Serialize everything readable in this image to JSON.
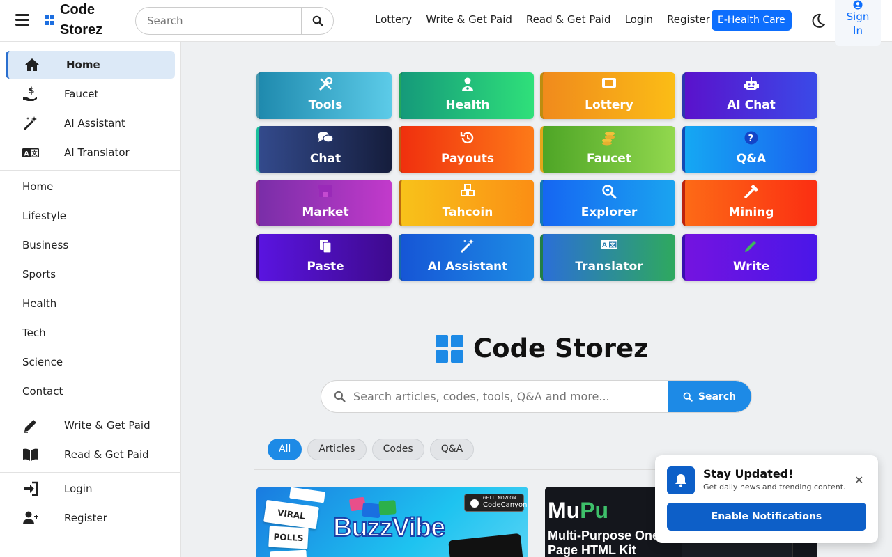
{
  "header": {
    "logo_text": "Code Storez",
    "search_placeholder": "Search",
    "nav": [
      "Lottery",
      "Write & Get Paid",
      "Read & Get Paid",
      "Login",
      "Register"
    ],
    "cta_label": "E-Health Care",
    "signin_label": "Sign In"
  },
  "sidebar": {
    "top_items": [
      "Home",
      "Faucet",
      "AI Assistant",
      "AI Translator"
    ],
    "categories": [
      "Home",
      "Lifestyle",
      "Business",
      "Sports",
      "Health",
      "Tech",
      "Science",
      "Contact"
    ],
    "earn_items": [
      "Write & Get Paid",
      "Read & Get Paid"
    ],
    "account_items": [
      "Login",
      "Register"
    ]
  },
  "tiles": [
    {
      "label": "Tools",
      "icon": "tools-icon"
    },
    {
      "label": "Health",
      "icon": "doctor-icon"
    },
    {
      "label": "Lottery",
      "icon": "ticket-icon"
    },
    {
      "label": "AI Chat",
      "icon": "robot-icon"
    },
    {
      "label": "Chat",
      "icon": "comments-icon"
    },
    {
      "label": "Payouts",
      "icon": "history-icon"
    },
    {
      "label": "Faucet",
      "icon": "coins-icon"
    },
    {
      "label": "Q&A",
      "icon": "question-icon"
    },
    {
      "label": "Market",
      "icon": "store-icon"
    },
    {
      "label": "Tahcoin",
      "icon": "cubes-icon"
    },
    {
      "label": "Explorer",
      "icon": "search-plus-icon"
    },
    {
      "label": "Mining",
      "icon": "hammer-icon"
    },
    {
      "label": "Paste",
      "icon": "paste-icon"
    },
    {
      "label": "AI Assistant",
      "icon": "magic-wand-icon"
    },
    {
      "label": "Translator",
      "icon": "language-icon"
    },
    {
      "label": "Write",
      "icon": "pen-icon"
    }
  ],
  "brand": {
    "title": "Code Storez"
  },
  "main_search": {
    "placeholder": "Search articles, codes, tools, Q&A and more...",
    "button": "Search"
  },
  "filters": {
    "items": [
      "All",
      "Articles",
      "Codes",
      "Q&A"
    ],
    "selected": "All"
  },
  "cards": [
    {
      "title": "BuzzVibe",
      "badge_small": "GET IT NOW ON",
      "badge_big": "CodeCanyon",
      "tags": [
        "VIRAL LISTS",
        "POLLS"
      ]
    },
    {
      "title_a": "Mu",
      "title_b": "Pu",
      "subtitle": "Multi-Purpose One-Page HTML Kit"
    }
  ],
  "toast": {
    "title": "Stay Updated!",
    "subtitle": "Get daily news and trending content.",
    "button": "Enable Notifications",
    "close": "✕"
  },
  "colors": {
    "primary": "#0d6efd",
    "accent": "#1d8ae6",
    "toast": "#0d5fc8"
  }
}
